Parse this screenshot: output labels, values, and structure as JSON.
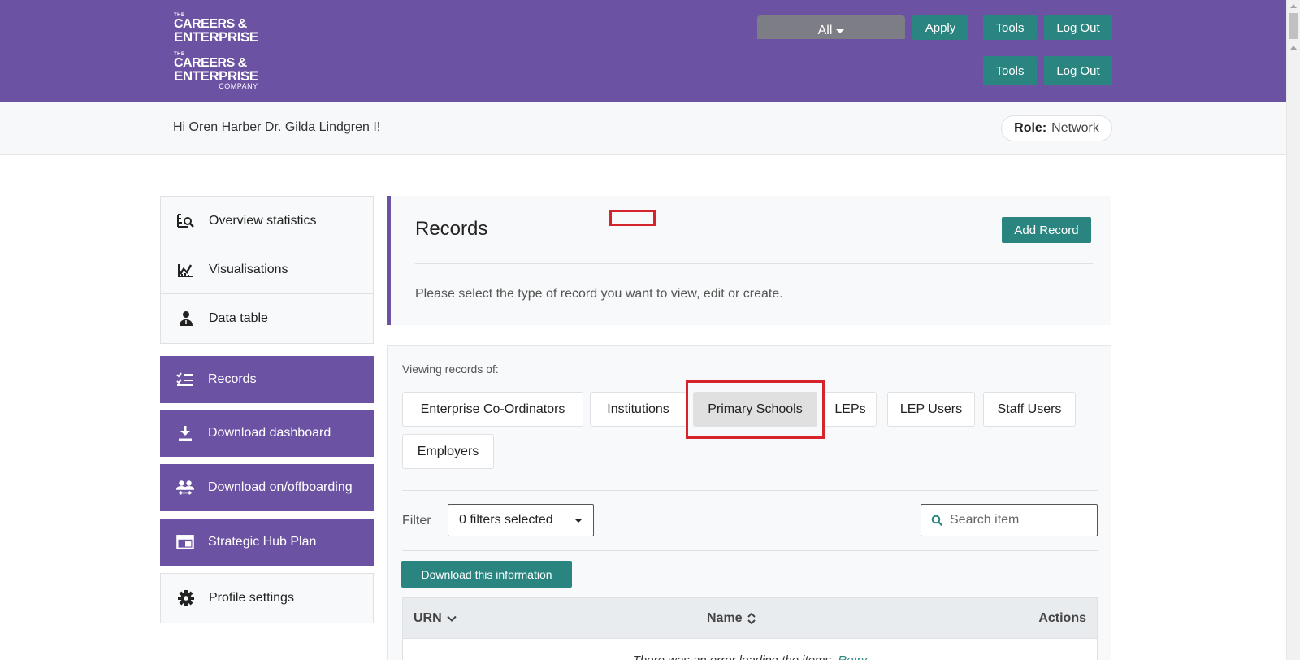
{
  "header": {
    "logo_top": {
      "the": "THE",
      "line1": "CAREERS &",
      "line2": "ENTERPRISE"
    },
    "logo_bottom": {
      "the": "THE",
      "line1": "CAREERS &",
      "line2": "ENTERPRISE",
      "line3": "COMPANY"
    },
    "select_value": "All",
    "apply_label": "Apply",
    "tools_label": "Tools",
    "logout_label": "Log Out"
  },
  "greeting": "Hi Oren Harber Dr. Gilda Lindgren I!",
  "role": {
    "label": "Role:",
    "value": "Network"
  },
  "sidebar": {
    "top_items": [
      {
        "label": "Overview statistics",
        "icon": "chart-search-icon"
      },
      {
        "label": "Visualisations",
        "icon": "line-chart-icon"
      },
      {
        "label": "Data table",
        "icon": "user-icon"
      }
    ],
    "purple_items": [
      {
        "label": "Records",
        "icon": "checklist-icon"
      },
      {
        "label": "Download dashboard",
        "icon": "download-icon"
      },
      {
        "label": "Download on/offboarding",
        "icon": "users-icon"
      },
      {
        "label": "Strategic Hub Plan",
        "icon": "window-icon"
      }
    ],
    "bottom_items": [
      {
        "label": "Profile settings",
        "icon": "gear-icon"
      }
    ]
  },
  "records": {
    "title": "Records",
    "add_label": "Add Record",
    "description": "Please select the type of record you want to view, edit or create."
  },
  "viewing": {
    "label": "Viewing records of:",
    "chips": [
      "Enterprise Co-Ordinators",
      "Institutions",
      "Primary Schools",
      "LEPs",
      "LEP Users",
      "Staff Users",
      "Employers"
    ],
    "active_chip": "Primary Schools"
  },
  "filter": {
    "label": "Filter",
    "selected": "0 filters selected",
    "search_placeholder": "Search item"
  },
  "download_label": "Download this information",
  "table": {
    "columns": [
      "URN",
      "Name",
      "Actions"
    ],
    "error_text": "There was an error loading the items.",
    "retry_label": "Retry"
  },
  "colors": {
    "brand_purple": "#6c52a2",
    "teal": "#2a8580",
    "highlight_red": "#d6242d"
  }
}
